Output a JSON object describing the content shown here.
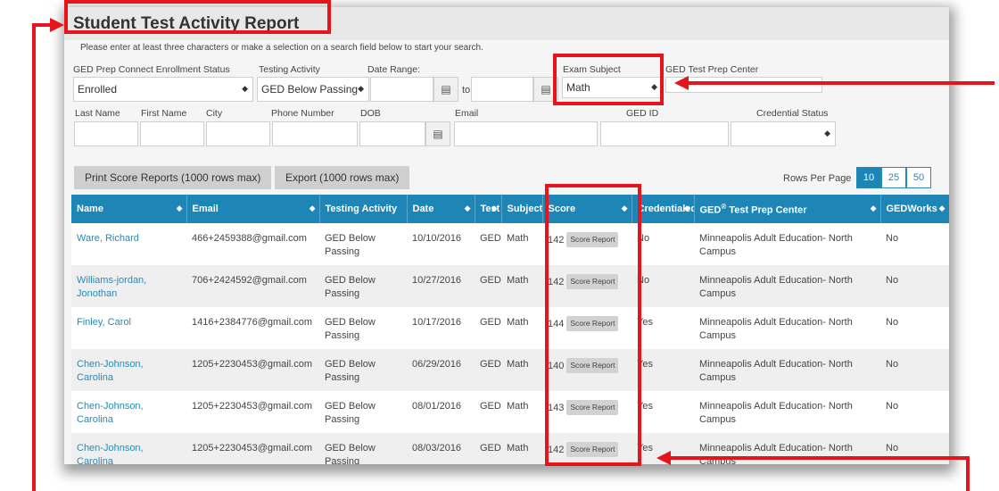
{
  "report": {
    "title": "Student Test Activity Report",
    "instruction": "Please enter at least three characters or make a selection on a search field below to start your search."
  },
  "filters": {
    "enrollment_label": "GED Prep Connect Enrollment Status",
    "enrollment_value": "Enrolled",
    "testing_activity_label": "Testing Activity",
    "testing_activity_value": "GED Below Passing",
    "date_range_label": "Date Range:",
    "date_to": "to",
    "exam_subject_label": "Exam Subject",
    "exam_subject_value": "Math",
    "test_prep_center_label": "GED Test Prep Center",
    "last_name_label": "Last Name",
    "first_name_label": "First Name",
    "city_label": "City",
    "phone_label": "Phone Number",
    "dob_label": "DOB",
    "email_label": "Email",
    "ged_id_label": "GED ID",
    "credential_status_label": "Credential Status"
  },
  "actions": {
    "print_label": "Print Score Reports (1000 rows max)",
    "export_label": "Export (1000 rows max)",
    "rows_per_page_label": "Rows Per Page",
    "rows_options": [
      "10",
      "25",
      "50"
    ],
    "rows_selected": "10"
  },
  "table": {
    "columns": [
      "Name",
      "Email",
      "Testing Activity",
      "Date",
      "Test",
      "Subject",
      "Score",
      "Credentialed",
      "GED",
      "GEDWorks"
    ],
    "center_header_suffix": " Test Prep Center",
    "score_badge_label": "Score Report",
    "rows": [
      {
        "name": "Ware, Richard",
        "email": "466+2459388@gmail.com",
        "activity": "GED Below Passing",
        "date": "10/10/2016",
        "test": "GED",
        "subject": "Math",
        "score": "142",
        "credentialed": "No",
        "center": "Minneapolis Adult Education- North Campus",
        "gedworks": "No"
      },
      {
        "name": "Williams-jordan, Jonothan",
        "email": "706+2424592@gmail.com",
        "activity": "GED Below Passing",
        "date": "10/27/2016",
        "test": "GED",
        "subject": "Math",
        "score": "142",
        "credentialed": "No",
        "center": "Minneapolis Adult Education- North Campus",
        "gedworks": "No"
      },
      {
        "name": "Finley, Carol",
        "email": "1416+2384776@gmail.com",
        "activity": "GED Below Passing",
        "date": "10/17/2016",
        "test": "GED",
        "subject": "Math",
        "score": "144",
        "credentialed": "Yes",
        "center": "Minneapolis Adult Education- North Campus",
        "gedworks": "No"
      },
      {
        "name": "Chen-Johnson, Carolina",
        "email": "1205+2230453@gmail.com",
        "activity": "GED Below Passing",
        "date": "06/29/2016",
        "test": "GED",
        "subject": "Math",
        "score": "140",
        "credentialed": "Yes",
        "center": "Minneapolis Adult Education- North Campus",
        "gedworks": "No"
      },
      {
        "name": "Chen-Johnson, Carolina",
        "email": "1205+2230453@gmail.com",
        "activity": "GED Below Passing",
        "date": "08/01/2016",
        "test": "GED",
        "subject": "Math",
        "score": "143",
        "credentialed": "Yes",
        "center": "Minneapolis Adult Education- North Campus",
        "gedworks": "No"
      },
      {
        "name": "Chen-Johnson, Carolina",
        "email": "1205+2230453@gmail.com",
        "activity": "GED Below Passing",
        "date": "08/03/2016",
        "test": "GED",
        "subject": "Math",
        "score": "142",
        "credentialed": "Yes",
        "center": "Minneapolis Adult Education- North Campus",
        "gedworks": "No"
      }
    ]
  },
  "icons": {
    "calendar": "calendar-icon",
    "select_caret": "select-caret-icon",
    "sort": "sort-icon"
  },
  "colors": {
    "header_blue": "#1e86b6",
    "link_blue": "#2a89b3",
    "annotation_red": "#e8141c"
  }
}
